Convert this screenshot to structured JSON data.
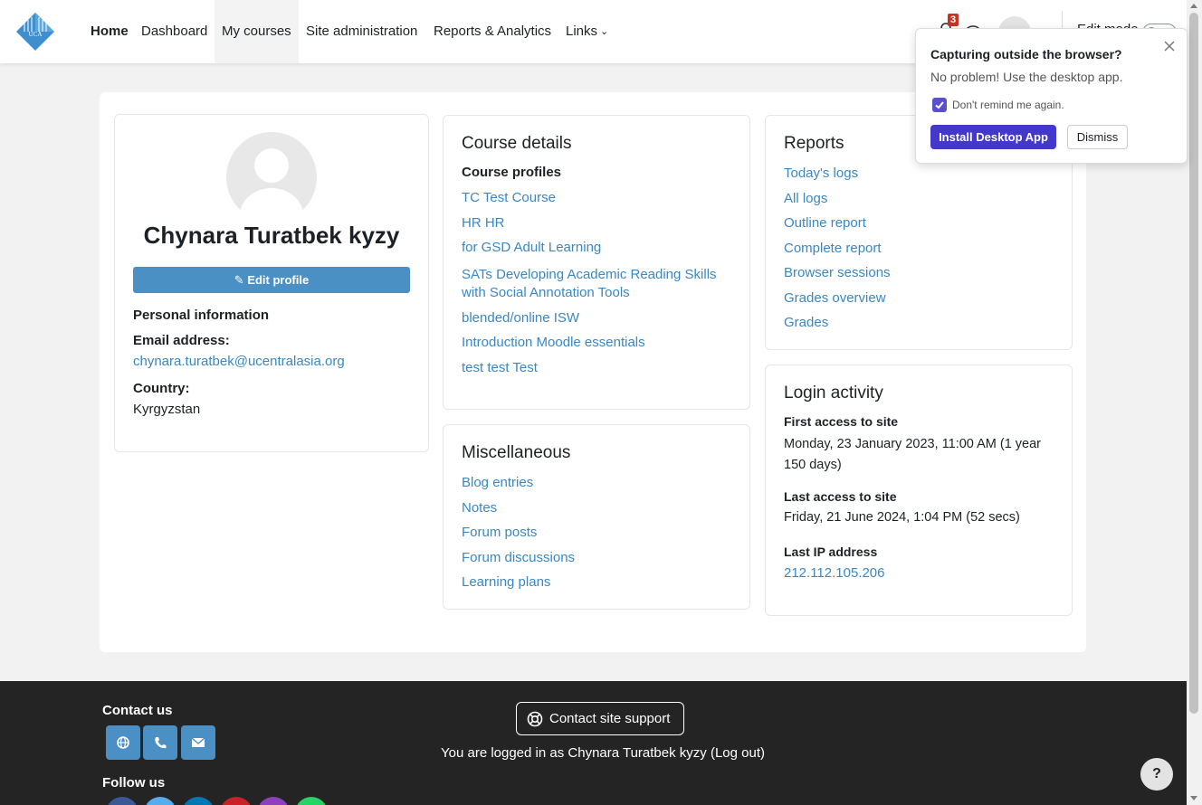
{
  "navbar": {
    "logo_text": "UCA",
    "items": [
      {
        "label": "Home"
      },
      {
        "label": "Dashboard"
      },
      {
        "label": "My courses"
      },
      {
        "label": "Site administration"
      },
      {
        "label": "Reports & Analytics"
      },
      {
        "label": "Links"
      }
    ],
    "notification_count": "3",
    "avatar_initials": "CT",
    "edit_mode_label": "Edit mode"
  },
  "profile": {
    "name": "Chynara Turatbek kyzy",
    "edit_button": "Edit profile",
    "personal_info_heading": "Personal information",
    "email_label": "Email address:",
    "email_value": "chynara.turatbek@ucentralasia.org",
    "country_label": "Country:",
    "country_value": "Kyrgyzstan"
  },
  "course_details": {
    "title": "Course details",
    "subheading": "Course profiles",
    "courses": [
      "TC Test Course",
      "HR HR",
      "for GSD Adult Learning",
      "SATs Developing Academic Reading Skills",
      "with Social Annotation Tools",
      "blended/online ISW",
      "Introduction Moodle essentials",
      "test test Test"
    ]
  },
  "miscellaneous": {
    "title": "Miscellaneous",
    "links": [
      "Blog entries",
      "Notes",
      "Forum posts",
      "Forum discussions",
      "Learning plans"
    ]
  },
  "reports": {
    "title": "Reports",
    "links": [
      "Today's logs",
      "All logs",
      "Outline report",
      "Complete report",
      "Browser sessions",
      "Grades overview",
      "Grades"
    ]
  },
  "login_activity": {
    "title": "Login activity",
    "first_access_label": "First access to site",
    "first_access_value_1": "Monday, 23 January 2023, 11:00 AM  (1 year",
    "first_access_value_2": "150 days)",
    "last_access_label": "Last access to site",
    "last_access_value": "Friday, 21 June 2024, 1:04 PM  (52 secs)",
    "last_ip_label": "Last IP address",
    "last_ip_value": "212.112.105.206"
  },
  "footer": {
    "contact_heading": "Contact us",
    "support_button": "Contact site support",
    "logged_in_text": "You are logged in as Chynara Turatbek kyzy (Log out)",
    "follow_heading": "Follow us",
    "help_label": "?",
    "social_colors": [
      "#3b5998",
      "#55acee",
      "#0077b5",
      "#cb2027",
      "#8e3fbf",
      "#25d366"
    ]
  },
  "popup": {
    "title": "Capturing outside the browser?",
    "subtitle": "No problem! Use the desktop app.",
    "checkbox_label": "Don't remind me again.",
    "install_button": "Install Desktop App",
    "dismiss_button": "Dismiss"
  },
  "colors": {
    "link": "#3a87c4",
    "primary_button": "#4a90c4",
    "footer_bg": "#242424",
    "install_button": "#4338ca"
  }
}
